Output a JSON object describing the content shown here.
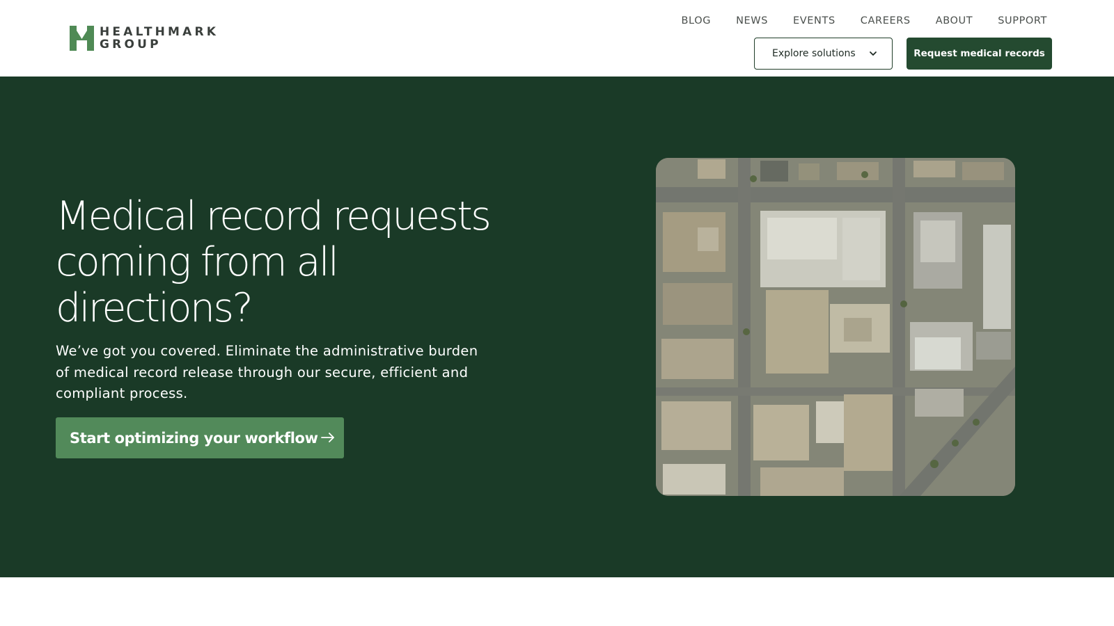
{
  "brand": {
    "name_line1": "HEALTHMARK",
    "name_line2": "GROUP",
    "logo_icon": "hm-logo-icon",
    "colors": {
      "dark_green": "#1a3a27",
      "button_green": "#244a30",
      "cta_green": "#528a5a",
      "logo_green": "#4f8a55"
    }
  },
  "nav": {
    "items": [
      {
        "label": "BLOG"
      },
      {
        "label": "NEWS"
      },
      {
        "label": "EVENTS"
      },
      {
        "label": "CAREERS"
      },
      {
        "label": "ABOUT"
      },
      {
        "label": "SUPPORT"
      }
    ],
    "explore_label": "Explore solutions",
    "explore_icon": "chevron-down-icon",
    "request_label": "Request medical records"
  },
  "hero": {
    "title": "Medical record requests coming from all directions?",
    "subtitle": "We’ve got you covered. Eliminate the administrative burden of medical record release through our secure, efficient and compliant process.",
    "cta_label": "Start optimizing your workflow",
    "cta_icon": "arrow-right-icon",
    "image_subject": "aerial-city-blocks-image"
  }
}
